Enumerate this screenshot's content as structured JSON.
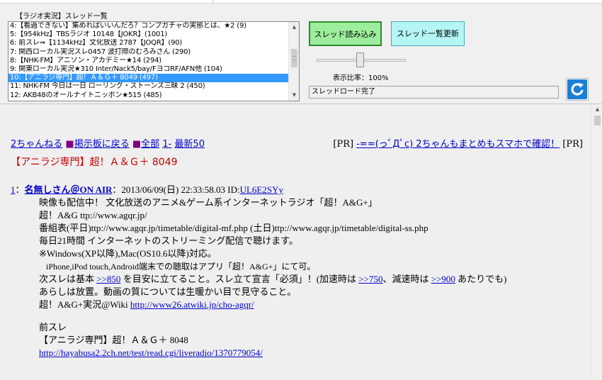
{
  "panel": {
    "group_label": "【ラジオ実況】スレッド一覧",
    "thread_items": [
      "4:【看過できない】集めればいいんだろ？コンプガチャの実態とは、★2 (9)",
      "5:【954kHz】TBSラジオ 10148【JOKR】(1001)",
      "6: 前スレ⇒【1134kHz】文化放送 2787【JOQR】(90)",
      "7: 関西ローカル実況スレ0457 波打際のむろみさん (290)",
      "8:【NHK-FM】アニソン・アカデミー★14 (294)",
      "9: 関東ローカル実況★310 Inter/Nack5/bay/FヨコRF/AFN他 (104)",
      "10:【アニラジ専門】超！Ａ＆Ｇ＋ 8049 (497)",
      "11: NHK-FM 今日は一日 ローリング・ストーンズ三昧 2 (450)",
      "12: AKB48のオールナイトニッポン★515 (485)"
    ],
    "selected_index": 6,
    "load_button": "スレッド読み込み",
    "refresh_button": "スレッド一覧更新",
    "zoom_label": "表示比率：100%",
    "zoom_percent": 100,
    "status_text": "スレッドロード完了",
    "reload_icon": "refresh-icon"
  },
  "browser": {
    "nav": {
      "bbs_link": "2ちゃんねる",
      "sep1": "■",
      "back_link": "掲示板に戻る",
      "sep2": "■",
      "all_link": "全部",
      "range_link": "1-",
      "latest_link": "最新50"
    },
    "pr": {
      "left": "[PR]",
      "link": "-==(っﾟДﾟc) 2ちゃんもまとめもスマホで確認！",
      "right": "[PR]"
    },
    "thread_title": "【アニラジ専門】超！Ａ＆Ｇ＋ 8049",
    "post": {
      "number": "1",
      "colon": "：",
      "name": "名無しさん＠",
      "name_link": "ON AIR",
      "date": "：2013/06/09(日) 22:33:58.03 ID:",
      "id": "UL6E2SYy",
      "lines": [
        "映像も配信中！ 文化放送のアニメ&ゲーム系インターネットラジオ「超！A&G+」",
        "超！A&G ttp://www.agqr.jp/",
        "番組表(平日)ttp://www.agqr.jp/timetable/digital-mf.php (土日)ttp://www.agqr.jp/timetable/digital-ss.php",
        "毎日21時間 インターネットのストリーミング配信で聴けます。",
        "※Windows(XP以降),Mac(OS10.6以降)対応。",
        "iPhone,iPod touch,Android端末での聴取はアプリ「超！A&G+」にて可。"
      ],
      "next_pre": "次スレは基本 ",
      "next_link1": ">>850",
      "next_mid": " を目安に立てること。スレ立て宣言「必須」！(加速時は ",
      "next_link2": ">>750",
      "next_mid2": "、減速時は ",
      "next_link3": ">>900",
      "next_post": " あたりでも)",
      "line_after": "あらしは放置。動画の質については生暖かい目で見守ること。",
      "wiki_label": "超！A&G+実況@Wiki ",
      "wiki_link": "http://www26.atwiki.jp/cho-agqr/",
      "prev_label": "前スレ",
      "prev_title": "【アニラジ専門】超！Ａ＆Ｇ＋ 8048",
      "prev_link": "http://hayabusa2.2ch.net/test/read.cgi/liveradio/1370779054/"
    }
  }
}
